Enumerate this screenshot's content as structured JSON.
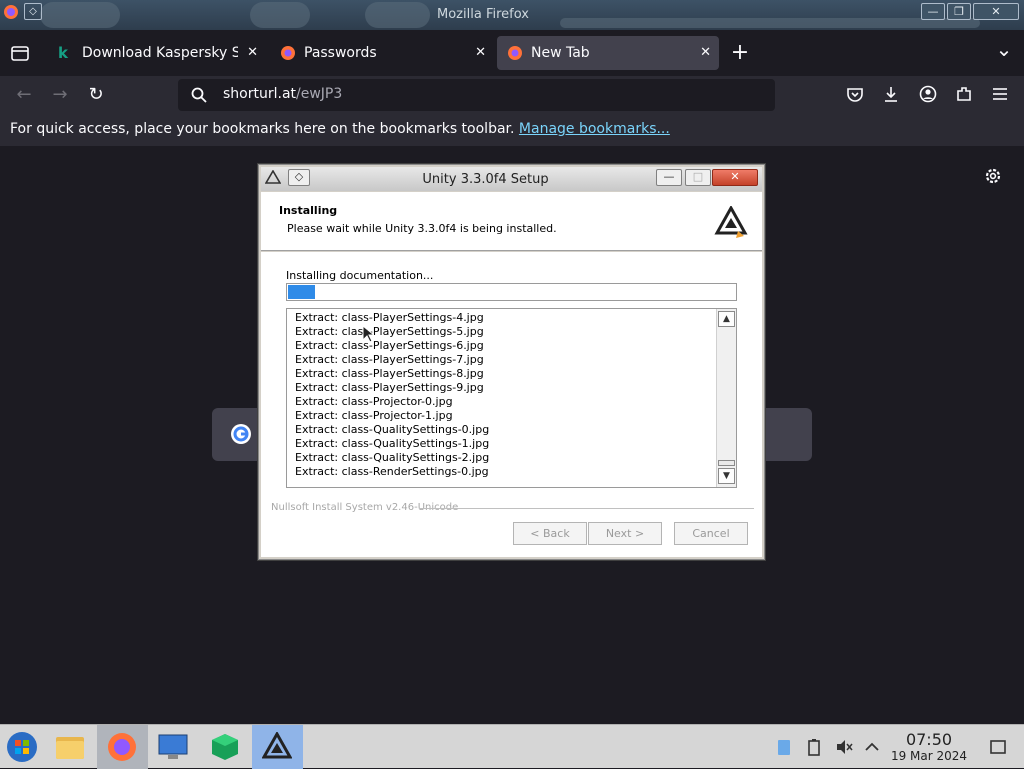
{
  "titlebar": {
    "title": "Mozilla Firefox",
    "minimize": "—",
    "maximize": "❐",
    "close": "✕"
  },
  "tabs": [
    {
      "label": "Download Kaspersky Sta",
      "close": "✕"
    },
    {
      "label": "Passwords",
      "close": "✕"
    },
    {
      "label": "New Tab",
      "close": "✕"
    }
  ],
  "tabstrip": {
    "new_tab": "+",
    "list_all": "⌄"
  },
  "navbar": {
    "url_host": "shorturl.at",
    "url_path": "/ewJP3"
  },
  "bookmarks": {
    "text": "For quick access, place your bookmarks here on the bookmarks toolbar. ",
    "link": "Manage bookmarks..."
  },
  "dialog": {
    "title": "Unity 3.3.0f4 Setup",
    "heading": "Installing",
    "subheading": "Please wait while Unity 3.3.0f4 is being installed.",
    "status": "Installing documentation...",
    "progress": 0.06,
    "log": [
      "Extract: class-PlayerSettings-4.jpg",
      "Extract: class-PlayerSettings-5.jpg",
      "Extract: class-PlayerSettings-6.jpg",
      "Extract: class-PlayerSettings-7.jpg",
      "Extract: class-PlayerSettings-8.jpg",
      "Extract: class-PlayerSettings-9.jpg",
      "Extract: class-Projector-0.jpg",
      "Extract: class-Projector-1.jpg",
      "Extract: class-QualitySettings-0.jpg",
      "Extract: class-QualitySettings-1.jpg",
      "Extract: class-QualitySettings-2.jpg",
      "Extract: class-RenderSettings-0.jpg"
    ],
    "branding": "Nullsoft Install System v2.46-Unicode",
    "back": "< Back",
    "next": "Next >",
    "cancel": "Cancel",
    "win_close": "✕"
  },
  "taskbar": {
    "time": "07:50",
    "date": "19 Mar 2024"
  },
  "colors": {
    "accent": "#2f8be8",
    "link": "#7ad4fb",
    "firefox_dark": "#1c1b22"
  }
}
